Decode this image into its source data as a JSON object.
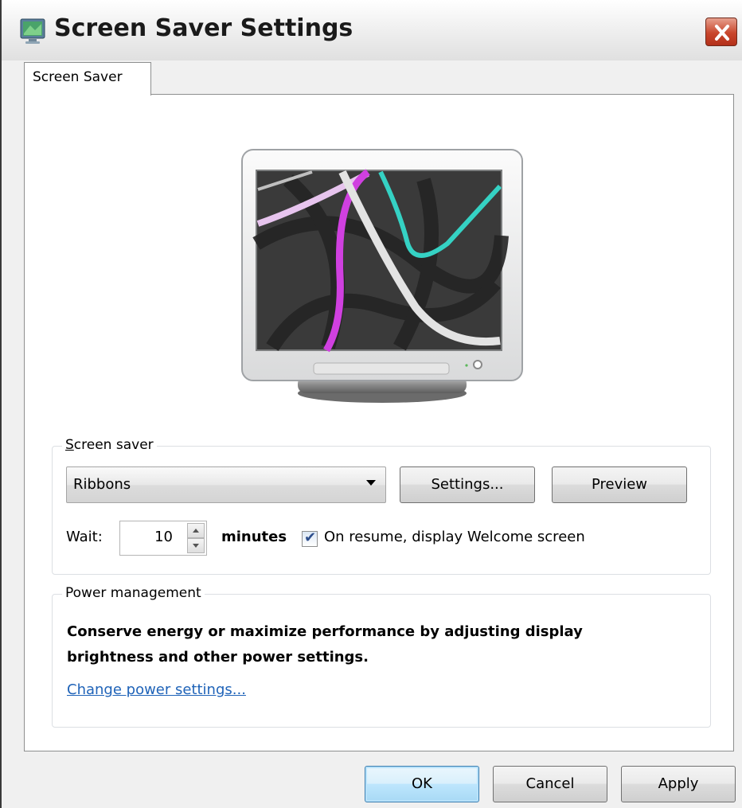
{
  "window": {
    "title": "Screen Saver Settings",
    "close_icon": "close-icon",
    "title_icon": "screen-saver-icon"
  },
  "tabs": [
    {
      "label": "Screen Saver",
      "active": true
    }
  ],
  "preview": {
    "image": "ribbons-preview-monitor"
  },
  "screen_saver_group": {
    "label": "Screen saver",
    "selected": "Ribbons",
    "settings_button": "Settings...",
    "preview_button": "Preview",
    "wait_label": "Wait:",
    "wait_value": "10",
    "minutes_label": "minutes",
    "resume_checked": true,
    "resume_label": "On resume, display Welcome screen"
  },
  "power_group": {
    "label": "Power management",
    "description": "Conserve energy or maximize performance by adjusting display brightness and other power settings.",
    "link": "Change power settings..."
  },
  "footer": {
    "ok": "OK",
    "cancel": "Cancel",
    "apply": "Apply"
  },
  "colors": {
    "accent_link": "#1f63b8",
    "close_button": "#c9462c",
    "default_button": "#bee6fd"
  }
}
